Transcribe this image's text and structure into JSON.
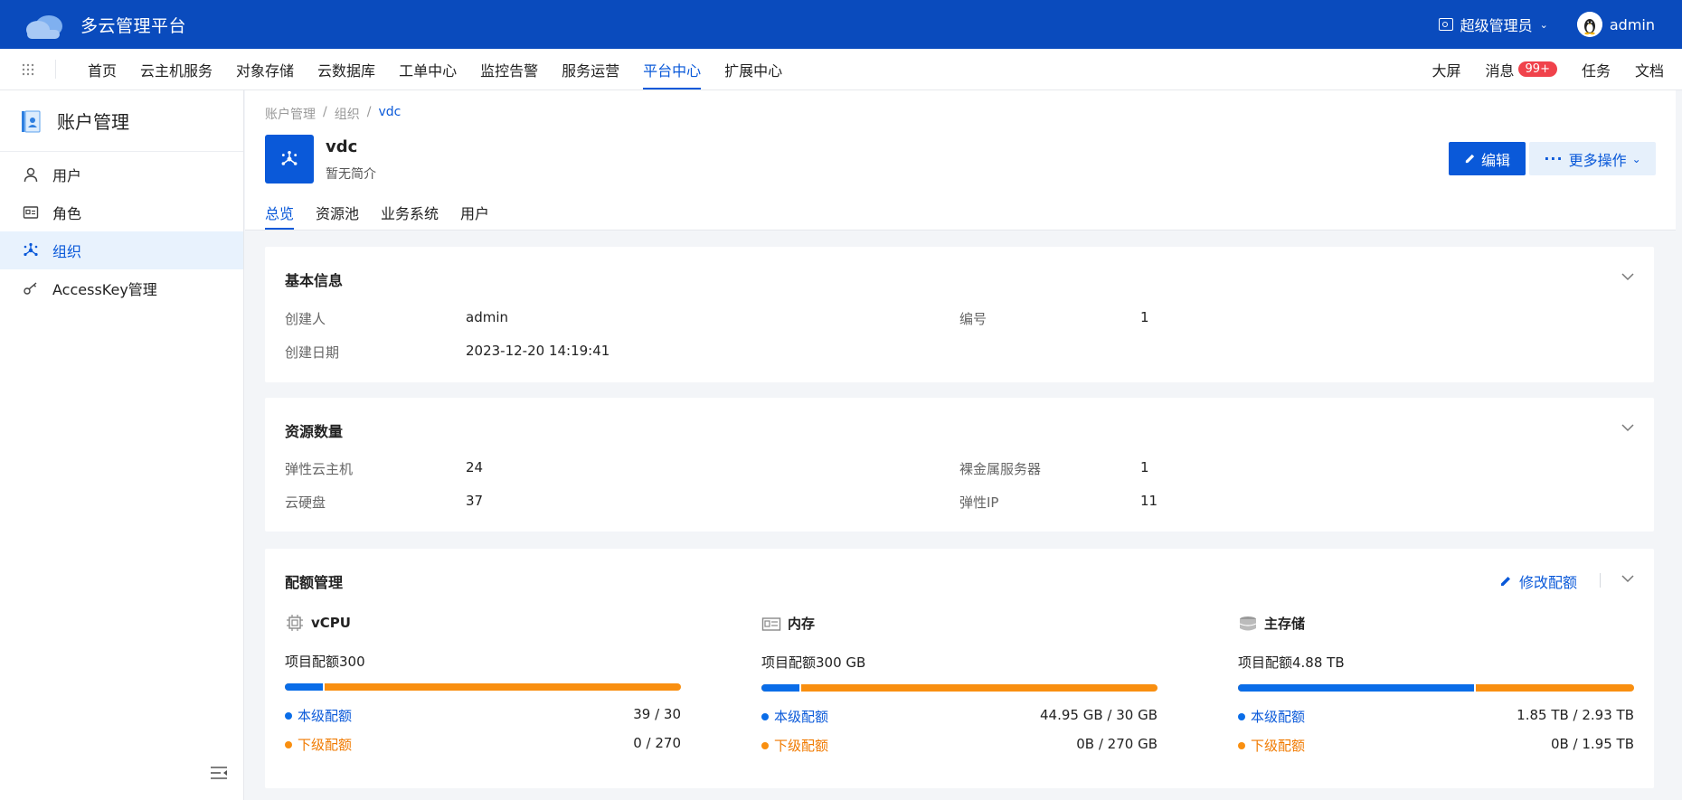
{
  "app": {
    "title": "多云管理平台"
  },
  "topbar": {
    "role": "超级管理员",
    "user": "admin"
  },
  "nav": {
    "items": [
      "首页",
      "云主机服务",
      "对象存储",
      "云数据库",
      "工单中心",
      "监控告警",
      "服务运营",
      "平台中心",
      "扩展中心"
    ],
    "active_index": 7,
    "right": {
      "screen": "大屏",
      "messages": "消息",
      "badge": "99+",
      "tasks": "任务",
      "docs": "文档"
    }
  },
  "sidebar": {
    "title": "账户管理",
    "items": [
      {
        "label": "用户",
        "icon": "user-icon"
      },
      {
        "label": "角色",
        "icon": "role-card-icon"
      },
      {
        "label": "组织",
        "icon": "organization-icon"
      },
      {
        "label": "AccessKey管理",
        "icon": "key-icon"
      }
    ],
    "active_index": 2
  },
  "breadcrumb": [
    "账户管理",
    "组织",
    "vdc"
  ],
  "org": {
    "name": "vdc",
    "desc": "暂无简介"
  },
  "actions": {
    "edit": "编辑",
    "more": "更多操作"
  },
  "tabs": [
    "总览",
    "资源池",
    "业务系统",
    "用户"
  ],
  "basic": {
    "title": "基本信息",
    "creator_label": "创建人",
    "creator": "admin",
    "id_label": "编号",
    "id": "1",
    "date_label": "创建日期",
    "date": "2023-12-20 14:19:41"
  },
  "resources": {
    "title": "资源数量",
    "ecs_label": "弹性云主机",
    "ecs": "24",
    "bm_label": "裸金属服务器",
    "bm": "1",
    "disk_label": "云硬盘",
    "disk": "37",
    "eip_label": "弹性IP",
    "eip": "11"
  },
  "quota": {
    "title": "配额管理",
    "edit": "修改配额",
    "own_label": "本级配额",
    "sub_label": "下级配额",
    "items": [
      {
        "name": "vCPU",
        "total": "项目配额300",
        "own": "39 / 30",
        "sub": "0 / 270",
        "own_fraction": 0.1
      },
      {
        "name": "内存",
        "total": "项目配额300 GB",
        "own": "44.95 GB / 30 GB",
        "sub": "0B / 270 GB",
        "own_fraction": 0.1
      },
      {
        "name": "主存储",
        "total": "项目配额4.88 TB",
        "own": "1.85 TB / 2.93 TB",
        "sub": "0B / 1.95 TB",
        "own_fraction": 0.6
      }
    ]
  },
  "colors": {
    "brand": "#0a4bbd",
    "accent": "#0a59d9",
    "own": "#0a6de8",
    "sub": "#f98f10"
  }
}
